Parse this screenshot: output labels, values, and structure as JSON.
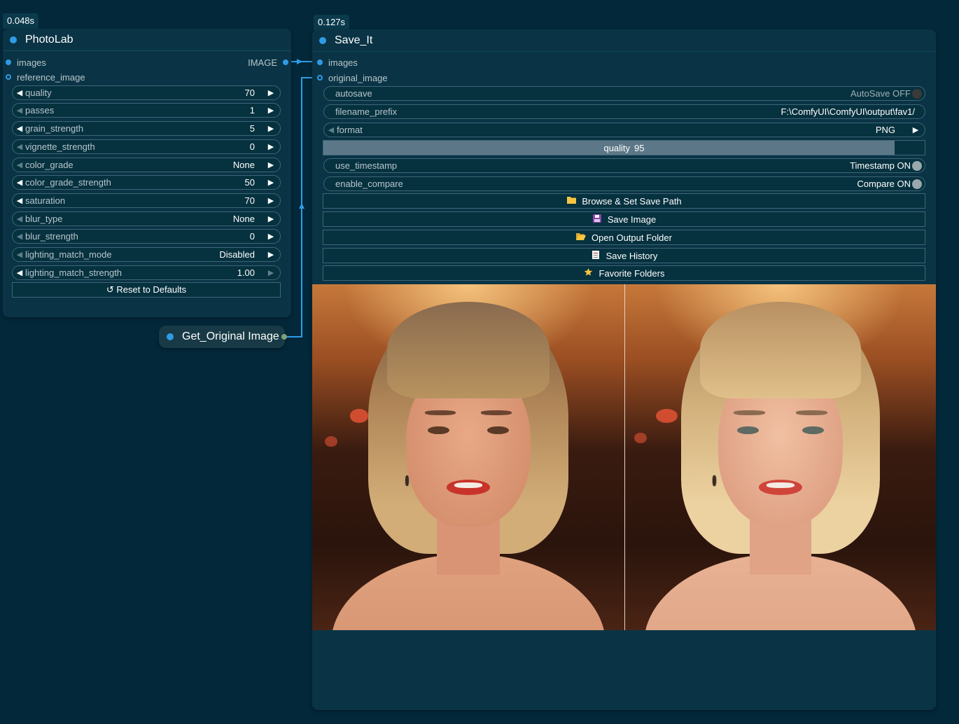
{
  "photolab": {
    "timing": "0.048s",
    "title": "PhotoLab",
    "inputs": [
      {
        "label": "images",
        "type": "IMAGE"
      },
      {
        "label": "reference_image"
      }
    ],
    "widgets": [
      {
        "label": "quality",
        "value": "70"
      },
      {
        "label": "passes",
        "value": "1"
      },
      {
        "label": "grain_strength",
        "value": "5"
      },
      {
        "label": "vignette_strength",
        "value": "0"
      },
      {
        "label": "color_grade",
        "value": "None"
      },
      {
        "label": "color_grade_strength",
        "value": "50"
      },
      {
        "label": "saturation",
        "value": "70"
      },
      {
        "label": "blur_type",
        "value": "None"
      },
      {
        "label": "blur_strength",
        "value": "0"
      },
      {
        "label": "lighting_match_mode",
        "value": "Disabled"
      },
      {
        "label": "lighting_match_strength",
        "value": "1.00"
      }
    ],
    "reset_button": "↺ Reset to Defaults"
  },
  "get_original": {
    "title": "Get_Original Image"
  },
  "save_it": {
    "timing": "0.127s",
    "title": "Save_It",
    "inputs": [
      {
        "label": "images"
      },
      {
        "label": "original_image"
      }
    ],
    "autosave": {
      "label": "autosave",
      "value": "AutoSave OFF"
    },
    "filename_prefix": {
      "label": "filename_prefix",
      "value": "F:\\ComfyUI\\ComfyUI\\output\\fav1/"
    },
    "format": {
      "label": "format",
      "value": "PNG"
    },
    "quality": {
      "label": "quality",
      "value": "95",
      "fill_fraction": 0.95
    },
    "use_timestamp": {
      "label": "use_timestamp",
      "value": "Timestamp ON"
    },
    "enable_compare": {
      "label": "enable_compare",
      "value": "Compare ON"
    },
    "buttons": [
      {
        "label": "Browse & Set Save Path",
        "icon": "folder-icon"
      },
      {
        "label": "Save Image",
        "icon": "floppy-disk-icon"
      },
      {
        "label": "Open Output Folder",
        "icon": "open-folder-icon"
      },
      {
        "label": "Save History",
        "icon": "document-icon"
      },
      {
        "label": "Favorite Folders",
        "icon": "star-icon"
      }
    ]
  },
  "colors": {
    "accent": "#2f9be6",
    "background": "#03283a",
    "node": "#0a3445",
    "folder": "#f5c542",
    "slider_fill": "#5c7888"
  }
}
